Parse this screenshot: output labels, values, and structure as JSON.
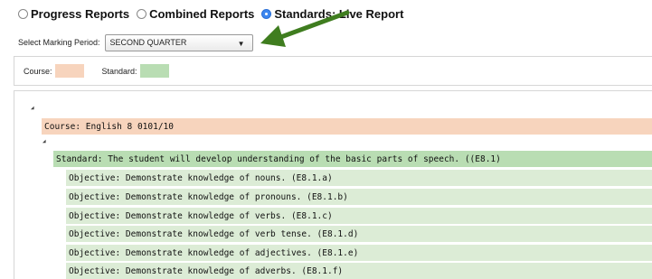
{
  "report_options": [
    {
      "label": "Progress Reports",
      "checked": false
    },
    {
      "label": "Combined Reports",
      "checked": false
    },
    {
      "label": "Standards: Live Report",
      "checked": true
    }
  ],
  "marking_period": {
    "label": "Select Marking Period:",
    "value": "SECOND QUARTER"
  },
  "legend": {
    "course_label": "Course:",
    "course_color": "#f7d4bd",
    "standard_label": "Standard:",
    "standard_color": "#b9ddb3"
  },
  "tree": {
    "course": "Course: English 8 0101/10",
    "standard": "Standard: The student will develop understanding of the basic parts of speech. ((E8.1)",
    "objectives": [
      "Objective: Demonstrate knowledge of nouns. (E8.1.a)",
      "Objective: Demonstrate knowledge of pronouns. (E8.1.b)",
      "Objective: Demonstrate knowledge of verbs. (E8.1.c)",
      "Objective: Demonstrate knowledge of verb tense. (E8.1.d)",
      "Objective: Demonstrate knowledge of adjectives. (E8.1.e)",
      "Objective: Demonstrate knowledge of adverbs. (E8.1.f)"
    ]
  },
  "annotation": {
    "arrow_color": "#3f7d1f"
  }
}
